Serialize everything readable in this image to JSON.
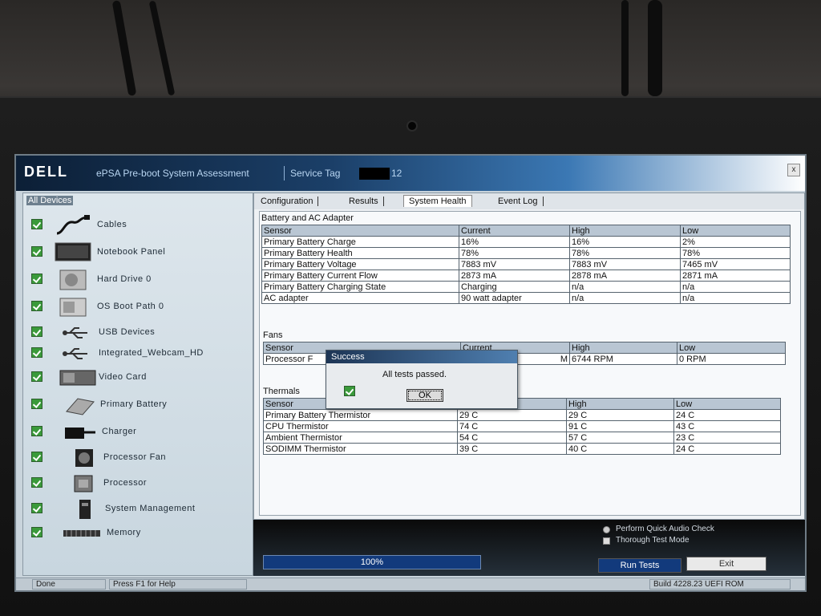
{
  "window": {
    "logo": "DELL",
    "title": "ePSA Pre-boot System Assessment",
    "service_tag_label": "Service Tag",
    "service_tag_suffix": "12",
    "close_glyph": "x"
  },
  "devices": {
    "header": "All Devices",
    "items": [
      {
        "label": "Cables",
        "icon": "cable-icon"
      },
      {
        "label": "Notebook Panel",
        "icon": "laptop-panel-icon"
      },
      {
        "label": "Hard Drive 0",
        "icon": "hard-drive-icon"
      },
      {
        "label": "OS Boot Path 0",
        "icon": "boot-path-icon"
      },
      {
        "label": "USB Devices",
        "icon": "usb-icon"
      },
      {
        "label": "Integrated_Webcam_HD",
        "icon": "usb-icon"
      },
      {
        "label": "Video Card",
        "icon": "video-card-icon"
      },
      {
        "label": "Primary Battery",
        "icon": "battery-icon"
      },
      {
        "label": "Charger",
        "icon": "charger-icon"
      },
      {
        "label": "Processor Fan",
        "icon": "fan-icon"
      },
      {
        "label": "Processor",
        "icon": "processor-icon"
      },
      {
        "label": "System Management",
        "icon": "system-management-icon"
      },
      {
        "label": "Memory",
        "icon": "memory-icon"
      }
    ]
  },
  "tabs": [
    {
      "label": "Configuration"
    },
    {
      "label": "Results"
    },
    {
      "label": "System Health"
    },
    {
      "label": "Event Log"
    }
  ],
  "battery": {
    "title": "Battery and AC Adapter",
    "headers": [
      "Sensor",
      "Current",
      "High",
      "Low"
    ],
    "rows": [
      [
        "Primary Battery Charge",
        "16%",
        "16%",
        "2%"
      ],
      [
        "Primary Battery Health",
        "78%",
        "78%",
        "78%"
      ],
      [
        "Primary Battery Voltage",
        "7883 mV",
        "7883 mV",
        "7465 mV"
      ],
      [
        "Primary Battery Current Flow",
        "2873 mA",
        "2878 mA",
        "2871 mA"
      ],
      [
        "Primary Battery Charging State",
        "Charging",
        "n/a",
        "n/a"
      ],
      [
        "AC adapter",
        "90 watt adapter",
        "n/a",
        "n/a"
      ]
    ]
  },
  "fans": {
    "title": "Fans",
    "headers": [
      "Sensor",
      "Current",
      "High",
      "Low"
    ],
    "rows": [
      [
        "Processor F",
        "M",
        "6744 RPM",
        "0 RPM"
      ]
    ]
  },
  "thermals": {
    "title": "Thermals",
    "headers": [
      "Sensor",
      "",
      "High",
      "Low"
    ],
    "rows": [
      [
        "Primary Battery Thermistor",
        "29 C",
        "29 C",
        "24 C"
      ],
      [
        "CPU Thermistor",
        "74 C",
        "91 C",
        "43 C"
      ],
      [
        "Ambient Thermistor",
        "54 C",
        "57 C",
        "23 C"
      ],
      [
        "SODIMM Thermistor",
        "39 C",
        "40 C",
        "24 C"
      ]
    ]
  },
  "dialog": {
    "title": "Success",
    "message": "All tests passed.",
    "ok_label": "OK"
  },
  "controls": {
    "progress_text": "100%",
    "progress_fraction": 1.0,
    "quick_audio_label": "Perform Quick Audio Check",
    "thorough_label": "Thorough Test Mode",
    "run_tests_label": "Run Tests",
    "exit_label": "Exit"
  },
  "status": {
    "state": "Done",
    "help": "Press F1 for Help",
    "build": "Build  4228.23 UEFI ROM"
  },
  "colors": {
    "title_bar": "#1b3f68",
    "progress": "#123a7c",
    "check": "#3a9a3a"
  }
}
